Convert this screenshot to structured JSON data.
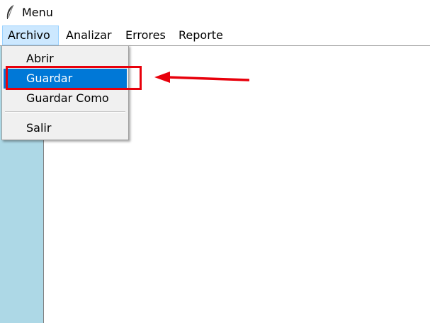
{
  "window": {
    "title": "Menu",
    "icon": "feather-icon"
  },
  "menubar": {
    "items": [
      {
        "label": "Archivo"
      },
      {
        "label": "Analizar"
      },
      {
        "label": "Errores"
      },
      {
        "label": "Reporte"
      }
    ]
  },
  "archivo_menu": {
    "items": [
      {
        "label": "Abrir"
      },
      {
        "label": "Guardar"
      },
      {
        "label": "Guardar Como"
      },
      {
        "label": "Salir"
      }
    ],
    "selected": "Guardar"
  },
  "colors": {
    "selection": "#0078d7",
    "menubar_active": "#cce8ff",
    "left_panel": "#add8e6",
    "annotation": "#e8000b"
  }
}
